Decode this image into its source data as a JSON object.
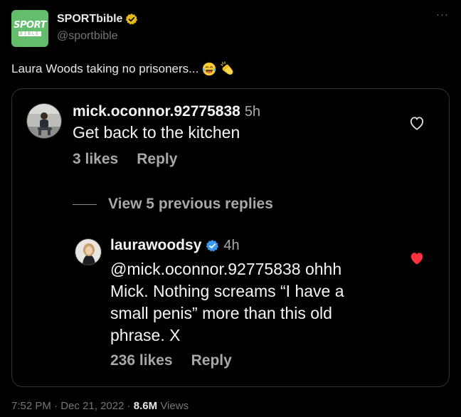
{
  "account": {
    "logo_top": "SPORT",
    "logo_bottom": "BIBLE",
    "display_name": "SPORTbible",
    "handle": "@sportbible",
    "verified_badge_icon": "gold-verified-badge-icon",
    "more_icon": "more-icon",
    "more_label": "···"
  },
  "tweet": {
    "text": "Laura Woods taking no prisoners...",
    "emojis": [
      "face-with-tears-of-joy-emoji",
      "clapping-hands-emoji"
    ]
  },
  "comments": [
    {
      "username": "mick.oconnor.92775838",
      "time": "5h",
      "body": "Get back to the kitchen",
      "likes": "3 likes",
      "reply_label": "Reply",
      "like_icon": "heart-outline-icon"
    },
    {
      "username": "laurawoodsy",
      "verified": true,
      "time": "4h",
      "body_lines": [
        "@mick.oconnor.92775838 ohhh",
        "Mick. Nothing screams “I have a",
        "small penis” more than this old",
        "phrase. X"
      ],
      "likes": "236 likes",
      "reply_label": "Reply",
      "like_icon": "heart-filled-icon"
    }
  ],
  "view_replies": "View 5 previous replies",
  "meta": {
    "time": "7:52 PM",
    "sep1": "·",
    "date": "Dec 21, 2022",
    "sep2": "·",
    "views_count": "8.6M",
    "views_label": "Views"
  },
  "colors": {
    "background": "#000000",
    "brand_green": "#62bd6d",
    "verified_gold": "#e2b719",
    "verified_blue": "#3897f0",
    "heart_red": "#ff3040",
    "muted": "#71767b"
  }
}
